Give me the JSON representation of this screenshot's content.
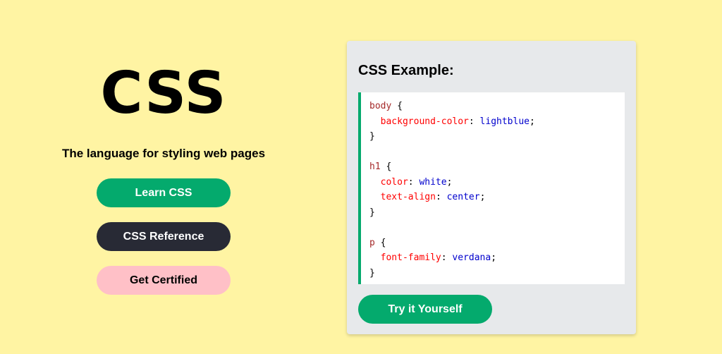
{
  "hero": {
    "title": "CSS",
    "subtitle": "The language for styling web pages",
    "buttons": {
      "learn": "Learn CSS",
      "reference": "CSS Reference",
      "certified": "Get Certified"
    }
  },
  "example": {
    "title": "CSS Example:",
    "code": {
      "body_selector": "body",
      "body_bg_prop": "background-color",
      "body_bg_val": "lightblue",
      "h1_selector": "h1",
      "h1_color_prop": "color",
      "h1_color_val": "white",
      "h1_align_prop": "text-align",
      "h1_align_val": "center",
      "p_selector": "p",
      "p_font_prop": "font-family",
      "p_font_val": "verdana"
    },
    "try_button": "Try it Yourself"
  },
  "colors": {
    "background": "#fff4a3",
    "green": "#04aa6d",
    "dark": "#282a35",
    "pink": "#ffc0c7",
    "card": "#e7e9eb",
    "selector": "#a52a2a",
    "property": "#ff0000",
    "value": "#0000cd"
  }
}
